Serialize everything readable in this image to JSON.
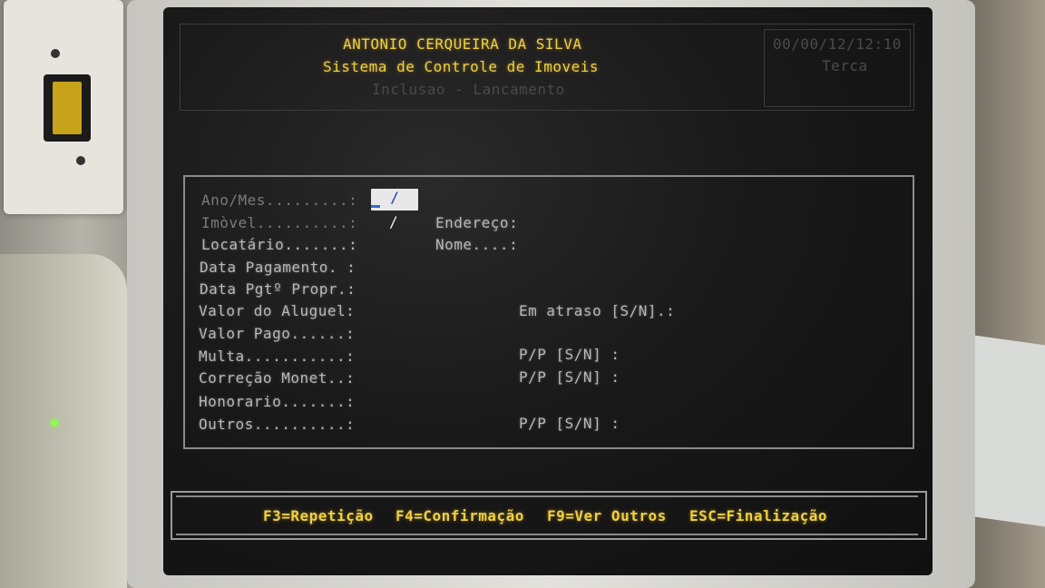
{
  "header": {
    "line1": "ANTONIO CERQUEIRA DA SILVA",
    "line2": "Sistema de Controle de Imoveis",
    "line3": "Inclusao - Lancamento",
    "date_line1": "00/00/12/12:10",
    "date_line2": "Terca"
  },
  "form": {
    "ano_mes": {
      "label": "Ano/Mes.........:",
      "value": "/"
    },
    "imovel": {
      "label": "Imòvel..........:",
      "value": "/"
    },
    "locatario": {
      "label": "Locatário.......:"
    },
    "data_pagamento": {
      "label": "Data Pagamento. :"
    },
    "data_pgt_propr": {
      "label": "Data Pgtº Propr.:"
    },
    "valor_aluguel": {
      "label": "Valor do Aluguel:"
    },
    "valor_pago": {
      "label": "Valor Pago......:"
    },
    "multa": {
      "label": "Multa...........:"
    },
    "correcao": {
      "label": "Correção Monet..:"
    },
    "honorario": {
      "label": "Honorario.......:"
    },
    "outros": {
      "label": "Outros..........:"
    },
    "endereco": {
      "label": "Endereço:"
    },
    "nome": {
      "label": "Nome....:"
    },
    "em_atraso": {
      "label": "Em atraso [S/N].:"
    },
    "pp_multa": {
      "label": "P/P [S/N] :"
    },
    "pp_correcao": {
      "label": "P/P [S/N] :"
    },
    "pp_outros": {
      "label": "P/P [S/N] :"
    }
  },
  "function_keys": {
    "f3": "F3=Repetição",
    "f4": "F4=Confirmação",
    "f9": "F9=Ver Outros",
    "esc": "ESC=Finalização"
  },
  "colors": {
    "title": "#f0d040",
    "label": "#b8b8b8",
    "screen_bg": "#161616"
  }
}
